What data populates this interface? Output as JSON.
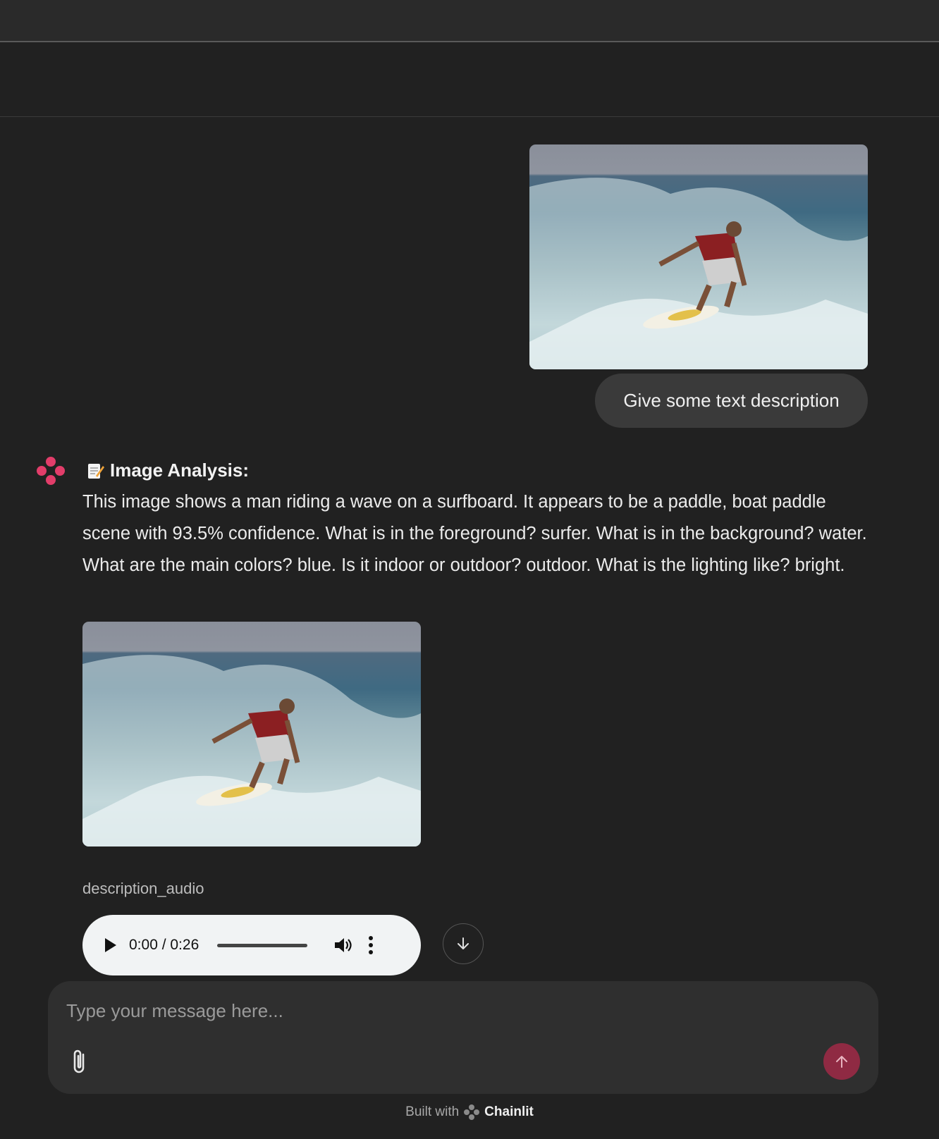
{
  "user_message": {
    "image_alt": "surfer riding a wave",
    "text": "Give some text description"
  },
  "assistant_message": {
    "title": "Image Analysis:",
    "body": "This image shows a man riding a wave on a surfboard. It appears to be a paddle, boat paddle scene with 93.5% confidence. What is in the foreground? surfer. What is in the background? water. What are the main colors? blue. Is it indoor or outdoor? outdoor. What is the lighting like? bright.",
    "image_alt": "surfer riding a wave",
    "audio": {
      "label": "description_audio",
      "time": "0:00 / 0:26",
      "progress": 0
    }
  },
  "composer": {
    "placeholder": "Type your message here..."
  },
  "footer": {
    "built_with": "Built with",
    "brand": "Chainlit"
  },
  "colors": {
    "accent": "#8f2a43",
    "logo_pink": "#e23d6a"
  }
}
